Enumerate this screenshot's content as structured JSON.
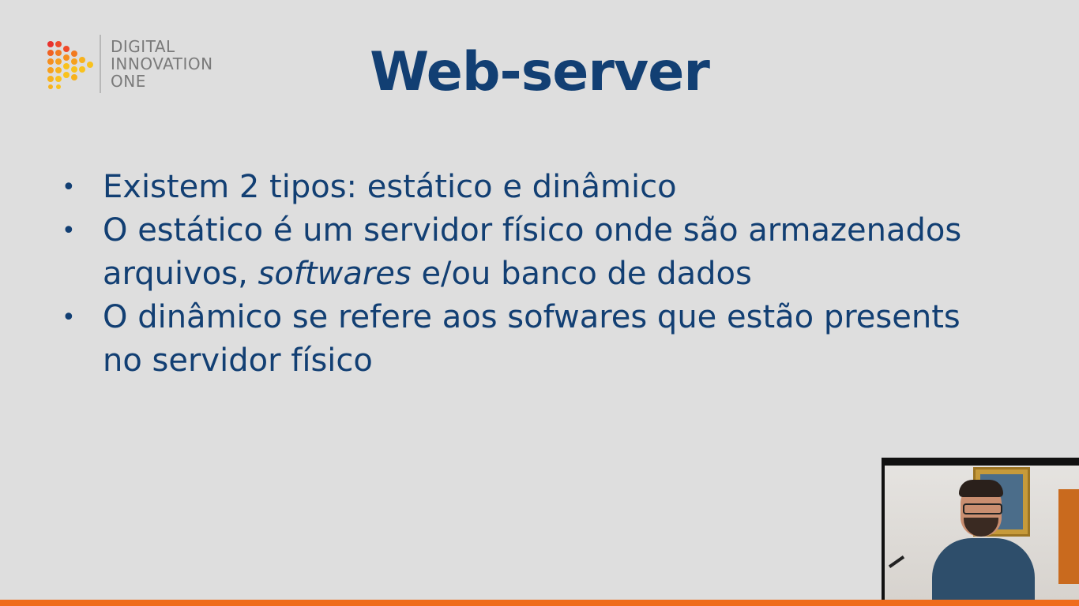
{
  "logo": {
    "line1": "DIGITAL",
    "line2": "INNOVATION",
    "line3": "ONE",
    "colors": [
      "#f47a20",
      "#f9c21d",
      "#e8322d"
    ]
  },
  "slide": {
    "title": "Web-server",
    "bullet_symbol": "•",
    "bullets": {
      "b1": {
        "text": "Existem 2 tipos: estático e dinâmico"
      },
      "b2": {
        "before": "O estático é um servidor físico onde são armazenados arquivos, ",
        "emphasis": "softwares",
        "after": " e/ou banco de dados"
      },
      "b3": {
        "text": "O dinâmico se refere aos sofwares que estão presents no servidor físico"
      }
    }
  },
  "colors": {
    "title": "#123f73",
    "text": "#123f73",
    "background": "#dedede",
    "accent_bar": "#ef6c1c"
  }
}
